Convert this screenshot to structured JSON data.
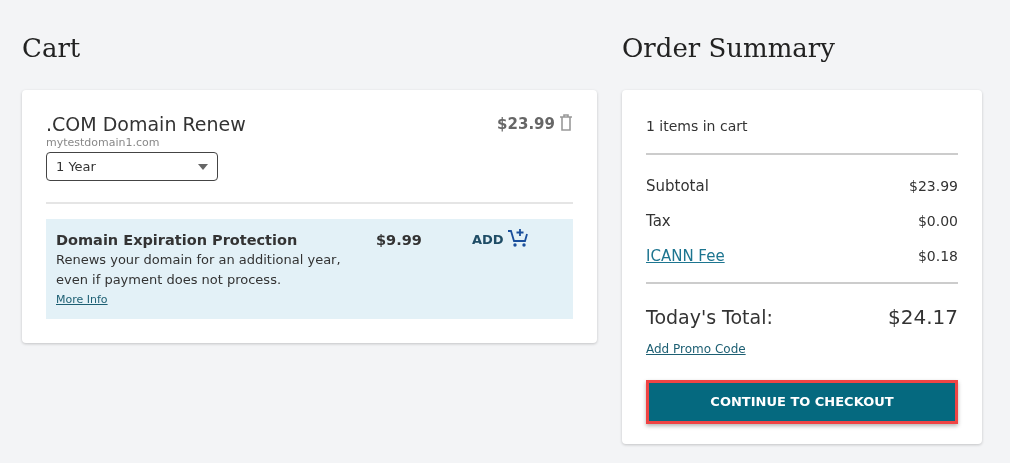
{
  "cart": {
    "title": "Cart",
    "item": {
      "name": ".COM Domain Renew",
      "domain": "mytestdomain1.com",
      "price": "$23.99",
      "term": "1 Year",
      "addon": {
        "name": "Domain Expiration Protection",
        "description": "Renews your domain for an additional year, even if payment does not process.",
        "link": "More Info",
        "price": "$9.99",
        "action": "ADD"
      }
    }
  },
  "summary": {
    "title": "Order Summary",
    "count": "1 items in cart",
    "rows": [
      {
        "kind": "text",
        "label": "Subtotal",
        "value": "$23.99"
      },
      {
        "kind": "text",
        "label": "Tax",
        "value": "$0.00"
      },
      {
        "kind": "link",
        "label": "ICANN Fee",
        "value": "$0.18"
      }
    ],
    "total_label": "Today's Total:",
    "total": "$24.17",
    "promo": "Add Promo Code",
    "checkout": {
      "label": "CONTINUE TO CHECKOUT",
      "highlighted": true
    }
  }
}
